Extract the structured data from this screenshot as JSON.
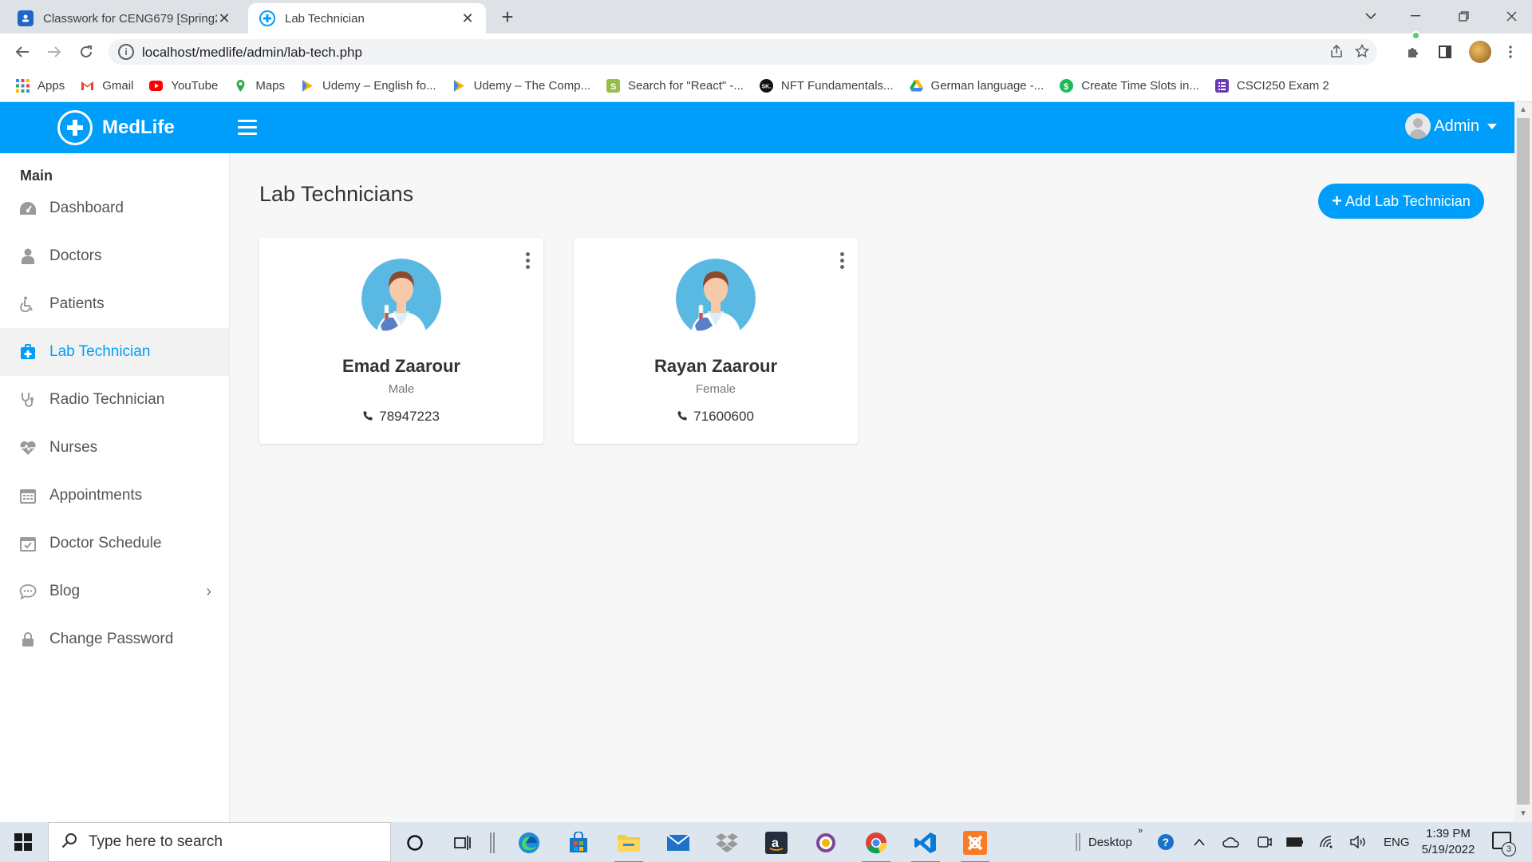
{
  "browser": {
    "tabs": [
      {
        "title": "Classwork for CENG679 [Spring2",
        "close": "✕",
        "active": false
      },
      {
        "title": "Lab Technician",
        "close": "✕",
        "active": true
      }
    ],
    "new_tab": "+",
    "url": "localhost/medlife/admin/lab-tech.php",
    "bookmarks": [
      {
        "label": "Apps",
        "icon": "apps-grid-icon",
        "color": "#4285f4"
      },
      {
        "label": "Gmail",
        "icon": "gmail-icon",
        "color": "#ea4335"
      },
      {
        "label": "YouTube",
        "icon": "youtube-icon",
        "color": "#ff0000"
      },
      {
        "label": "Maps",
        "icon": "maps-icon",
        "color": "#34a853"
      },
      {
        "label": "Udemy – English fo...",
        "icon": "udemy-icon",
        "color": "#f4b400"
      },
      {
        "label": "Udemy – The Comp...",
        "icon": "udemy-icon",
        "color": "#f4b400"
      },
      {
        "label": "Search for \"React\" -...",
        "icon": "shopify-icon",
        "color": "#95bf47"
      },
      {
        "label": "NFT Fundamentals...",
        "icon": "sk-icon",
        "color": "#111111"
      },
      {
        "label": "German language -...",
        "icon": "drive-icon",
        "color": "#fbbc04"
      },
      {
        "label": "Create Time Slots in...",
        "icon": "dollar-icon",
        "color": "#1db954"
      },
      {
        "label": "CSCI250 Exam 2",
        "icon": "forms-icon",
        "color": "#673ab7"
      }
    ]
  },
  "app": {
    "brand": "MedLife",
    "user": "Admin",
    "sidebar": {
      "heading": "Main",
      "items": [
        {
          "label": "Dashboard",
          "icon": "dashboard-icon",
          "glyph": "◕"
        },
        {
          "label": "Doctors",
          "icon": "doctor-icon",
          "glyph": "♟"
        },
        {
          "label": "Patients",
          "icon": "wheelchair-icon",
          "glyph": "♿"
        },
        {
          "label": "Lab Technician",
          "icon": "hospital-icon",
          "glyph": "✚",
          "active": true
        },
        {
          "label": "Radio Technician",
          "icon": "stethoscope-icon",
          "glyph": "⚕"
        },
        {
          "label": "Nurses",
          "icon": "heartbeat-icon",
          "glyph": "♥"
        },
        {
          "label": "Appointments",
          "icon": "calendar-icon",
          "glyph": "▦"
        },
        {
          "label": "Doctor Schedule",
          "icon": "calendar-check-icon",
          "glyph": "☑"
        },
        {
          "label": "Blog",
          "icon": "comments-icon",
          "glyph": "☁",
          "chevron": "›"
        },
        {
          "label": "Change Password",
          "icon": "lock-icon",
          "glyph": "🔒"
        }
      ]
    },
    "page_title": "Lab Technicians",
    "add_button": "Add Lab Technician",
    "technicians": [
      {
        "name": "Emad Zaarour",
        "gender": "Male",
        "phone": "78947223"
      },
      {
        "name": "Rayan Zaarour",
        "gender": "Female",
        "phone": "71600600"
      }
    ],
    "accent_color": "#009efb"
  },
  "taskbar": {
    "search_placeholder": "Type here to search",
    "desktop_label": "Desktop",
    "language": "ENG",
    "time": "1:39 PM",
    "date": "5/19/2022",
    "notification_count": "3"
  }
}
